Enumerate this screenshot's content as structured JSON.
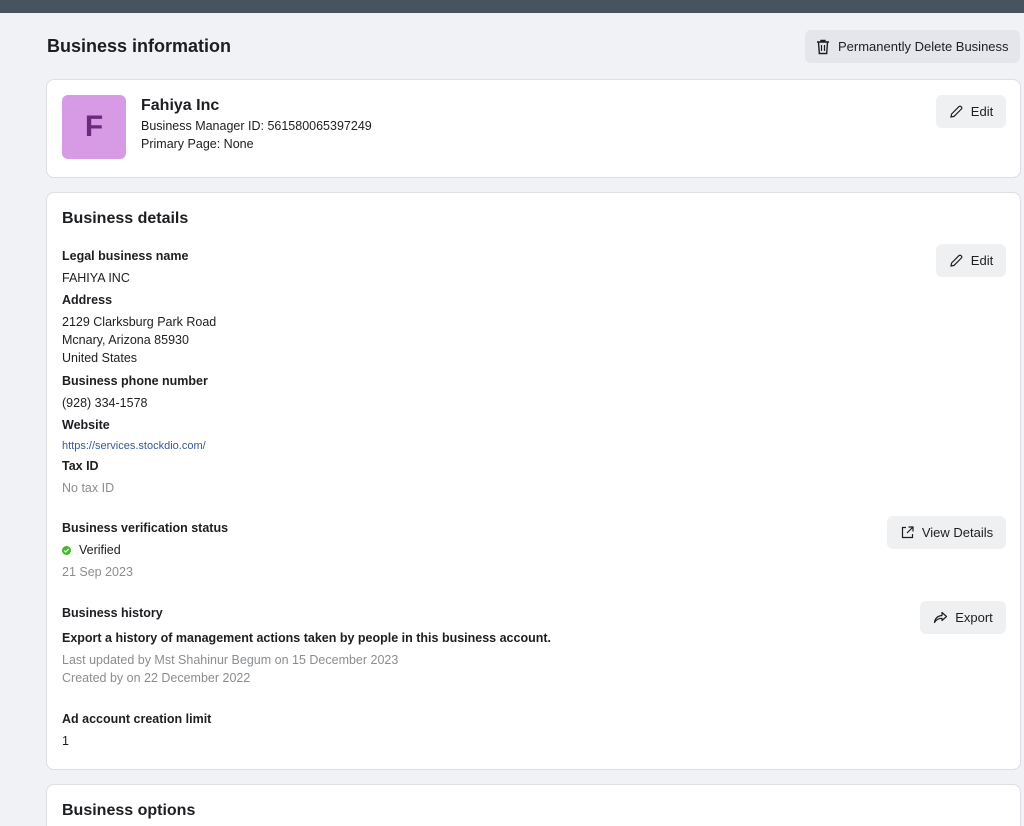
{
  "page": {
    "title": "Business information",
    "delete_button": "Permanently Delete Business"
  },
  "profile": {
    "avatar_letter": "F",
    "name": "Fahiya Inc",
    "manager_id": "Business Manager ID: 561580065397249",
    "primary_page": "Primary Page: None",
    "edit_label": "Edit"
  },
  "details": {
    "title": "Business details",
    "edit_label": "Edit",
    "legal_name_label": "Legal business name",
    "legal_name": "FAHIYA INC",
    "address_label": "Address",
    "address_line1": "2129 Clarksburg Park Road",
    "address_line2": "Mcnary, Arizona 85930",
    "address_line3": "United States",
    "phone_label": "Business phone number",
    "phone": "(928) 334-1578",
    "website_label": "Website",
    "website": "https://services.stockdio.com/",
    "tax_label": "Tax ID",
    "tax": "No tax ID",
    "verification_label": "Business verification status",
    "verification_status": "Verified",
    "verification_date": "21 Sep 2023",
    "view_details_label": "View Details",
    "history_label": "Business history",
    "history_desc": "Export a history of management actions taken by people in this business account.",
    "history_updated": "Last updated by Mst Shahinur Begum on 15 December 2023",
    "history_created": "Created by on 22 December 2022",
    "export_label": "Export",
    "ad_limit_label": "Ad account creation limit",
    "ad_limit": "1"
  },
  "options": {
    "title": "Business options"
  },
  "colors": {
    "topbar": "#47535f",
    "avatar": "#d79be6",
    "verified": "#42b72a",
    "link": "#385898"
  },
  "icons": [
    "trash-icon",
    "pencil-icon",
    "external-link-icon",
    "share-icon",
    "check-dot-icon"
  ]
}
